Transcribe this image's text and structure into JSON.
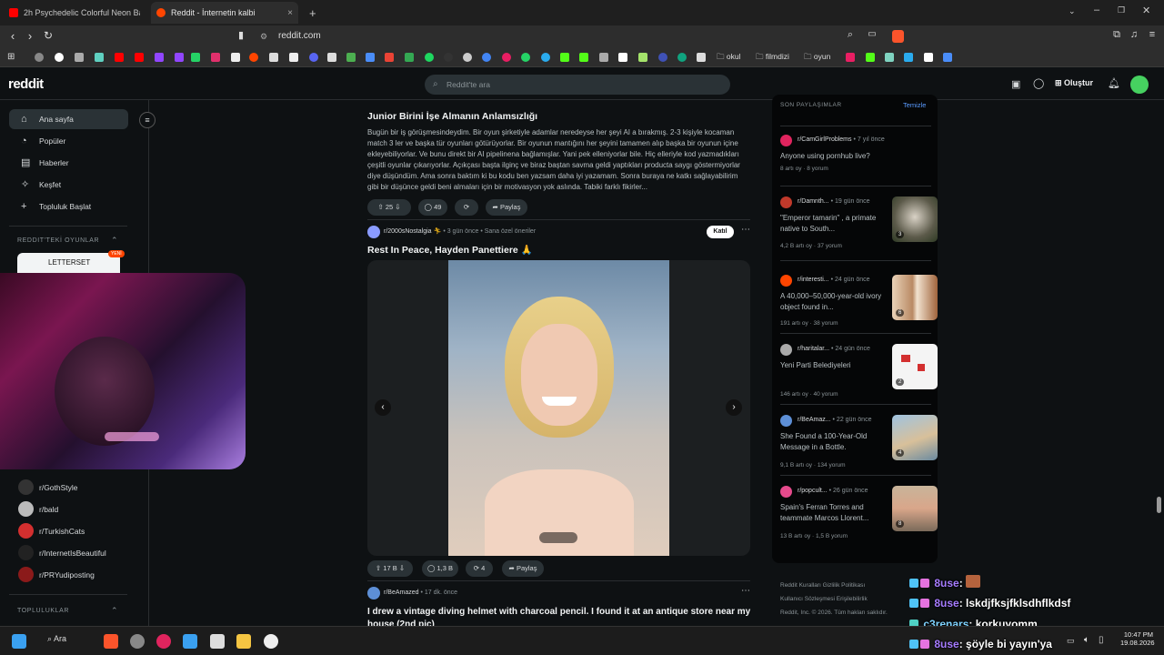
{
  "browser": {
    "tabs": [
      {
        "title": "2h Psychedelic Colorful Neon Backgr",
        "close": ""
      },
      {
        "title": "Reddit - İnternetin kalbi",
        "close": "×"
      }
    ],
    "new_tab": "+",
    "url": "reddit.com",
    "bookmark_folders": [
      "okul",
      "filmdizi",
      "oyun"
    ]
  },
  "header": {
    "logo": "reddit",
    "search_placeholder": "Reddit'te ara",
    "create_label": "Oluştur"
  },
  "left_nav": {
    "items": [
      "Ana sayfa",
      "Popüler",
      "Haberler",
      "Keşfet",
      "Topluluk Başlat"
    ],
    "games_section": "REDDIT'TEKİ OYUNLAR",
    "game_card": {
      "title": "LETTERSET",
      "badge": "YENİ"
    },
    "communities": [
      "r/GothStyle",
      "r/bald",
      "r/TurkishCats",
      "r/InternetIsBeautiful",
      "r/PRYudiposting"
    ],
    "communities_section": "TOPLULUKLAR"
  },
  "feed": {
    "post1": {
      "title": "Junior Birini İşe Almanın Anlamsızlığı",
      "body": "Bugün bir iş görüşmesindeydim. Bir oyun şirketiyle adamlar neredeyse her şeyi AI a bırakmış. 2-3 kişiyle kocaman match 3 ler ve başka tür oyunları götürüyorlar. Bir oyunun mantığını her şeyini tamamen alıp başka bir oyunun içine ekleyebiliyorlar. Ve bunu direkt bir AI pipelinena bağlamışlar. Yani pek elleniyorlar bile. Hiç elleriyle kod yazmadıkları çeşitli oyunlar çıkarıyorlar. Açıkçası başta ilginç ve biraz baştan savma geldi yaptıkları producta saygı göstermiyorlar diye düşündüm. Ama sonra baktım ki bu kodu ben yazsam daha iyi yazamam. Sonra buraya ne katkı sağlayabilirim gibi bir düşünce geldi beni almaları için bir motivasyon yok aslında. Tabiki farklı fikirler...",
      "votes": "25",
      "comments": "49",
      "share": "Paylaş"
    },
    "post2": {
      "subreddit": "r/2000sNostalgia",
      "time": "• 3 gün önce",
      "suggest": "• Sana özel öneriler",
      "join": "Katıl",
      "title": "Rest In Peace, Hayden Panettiere 🙏",
      "votes": "17 B",
      "comments": "1,3 B",
      "crossposts": "4",
      "share": "Paylaş"
    },
    "post3": {
      "subreddit": "r/BeAmazed",
      "time": "• 17 dk. önce",
      "title": "I drew a vintage diving helmet with charcoal pencil. I found it at an antique store near my house (2nd pic)"
    }
  },
  "right_panel": {
    "header": "SON PAYLAŞIMLAR",
    "clear": "Temizle",
    "items": [
      {
        "sub": "r/CamGirlProblems",
        "time": "• 7 yıl önce",
        "title": "Anyone using pornhub live?",
        "stats": "8 artı oy · 8 yorum",
        "count": ""
      },
      {
        "sub": "r/Damnth...",
        "time": "• 19 gün önce",
        "title": "\"Emperor tamarin\" , a primate native to South...",
        "stats": "4,2 B artı oy · 37 yorum",
        "count": "3"
      },
      {
        "sub": "r/interesti...",
        "time": "• 24 gün önce",
        "title": "A 40,000–50,000-year-old ivory object found in...",
        "stats": "191 artı oy · 38 yorum",
        "count": "6"
      },
      {
        "sub": "r/haritalar...",
        "time": "• 24 gün önce",
        "title": "Yeni Parti Belediyeleri",
        "stats": "146 artı oy · 40 yorum",
        "count": "2"
      },
      {
        "sub": "r/BeAmaz...",
        "time": "• 22 gün önce",
        "title": "She Found a 100-Year-Old Message in a Bottle.",
        "stats": "9,1 B artı oy · 134 yorum",
        "count": "4"
      },
      {
        "sub": "r/popcult...",
        "time": "• 26 gün önce",
        "title": "Spain's Ferran Torres and teammate Marcos Llorent...",
        "stats": "13 B artı oy · 1,5 B yorum",
        "count": "8"
      }
    ],
    "footer": [
      "Reddit Kuralları   Gizlilik Politikası",
      "Kullanıcı Sözleşmesi   Erişilebilirlik",
      "Reddit, Inc. © 2026. Tüm hakları saklıdır."
    ]
  },
  "chat": [
    {
      "name": "8use",
      "msg": ": "
    },
    {
      "name": "8use",
      "msg": ": lskdjfksjfklsdhflkdsf"
    },
    {
      "name": "c3renars",
      "msg": ": korkuyomm"
    },
    {
      "name": "8use",
      "msg": ": şöyle bi yayın'ya"
    }
  ],
  "taskbar": {
    "search": "Ara",
    "time": "10:47 PM",
    "date": "19.08.2026"
  }
}
